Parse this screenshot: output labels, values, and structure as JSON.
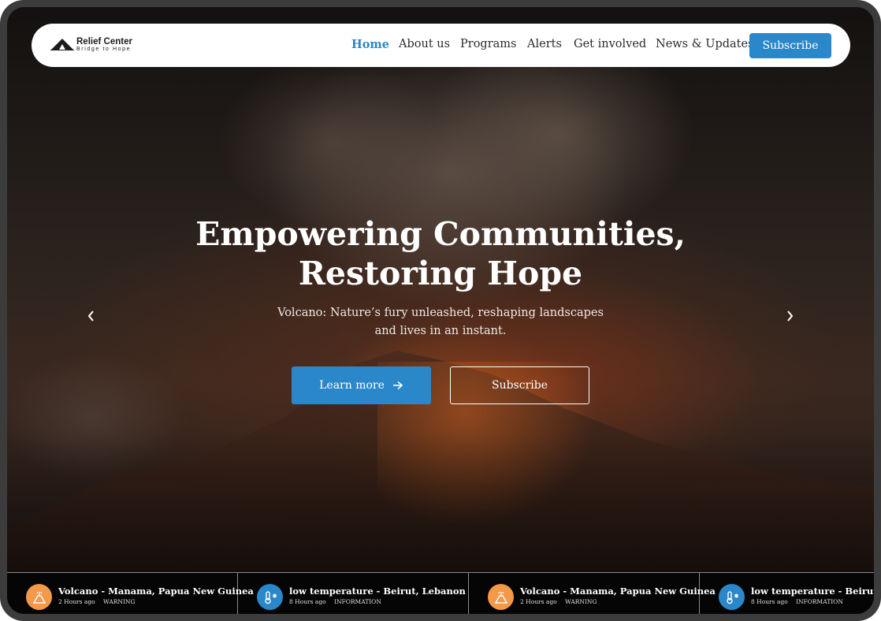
{
  "brand": {
    "name": "Relief Center",
    "tagline": "Bridge to Hope"
  },
  "nav": {
    "items": [
      {
        "label": "Home",
        "active": true
      },
      {
        "label": "About us"
      },
      {
        "label": "Programs"
      },
      {
        "label": "Alerts"
      },
      {
        "label": "Get involved"
      },
      {
        "label": "News & Updates"
      }
    ],
    "subscribe_label": "Subscribe"
  },
  "hero": {
    "title_line1": "Empowering Communities,",
    "title_line2": "Restoring Hope",
    "description": "Volcano: Nature’s fury unleashed, reshaping landscapes and lives in an instant.",
    "learn_more_label": "Learn more",
    "subscribe_label": "Subscribe",
    "prev_icon": "chevron-left-icon",
    "next_icon": "chevron-right-icon"
  },
  "alerts": [
    {
      "title": "Volcano - Manama, Papua New Guinea",
      "time": "2 Hours ago",
      "level": "WARNING",
      "icon": "volcano-icon",
      "color": "#f2994a"
    },
    {
      "title": "low temperature - Beirut, Lebanon",
      "time": "8 Hours ago",
      "level": "INFORMATION",
      "icon": "thermometer-icon",
      "color": "#2a87c9"
    },
    {
      "title": "Volcano - Manama, Papua New Guinea",
      "time": "2 Hours ago",
      "level": "WARNING",
      "icon": "volcano-icon",
      "color": "#f2994a"
    },
    {
      "title": "low temperature - Beirut, Lebanon",
      "time": "8 Hours ago",
      "level": "INFORMATION",
      "icon": "thermometer-icon",
      "color": "#2a87c9"
    }
  ],
  "colors": {
    "accent": "#2a87c9",
    "warning": "#f2994a",
    "ticker_bg": "#050505",
    "frame": "#3c3c3c"
  }
}
